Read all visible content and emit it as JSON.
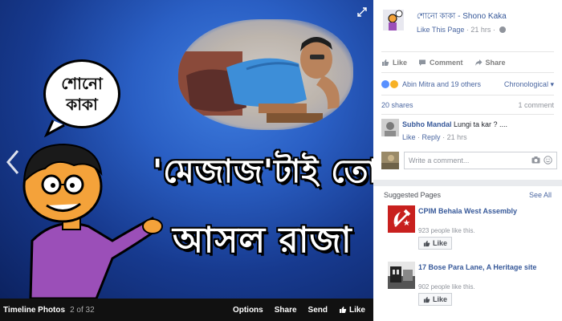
{
  "viewer": {
    "headline_1": "'মেজাজ'টাই তো",
    "headline_2": "আসল রাজা",
    "bubble_text": "শোনো\nকাকা",
    "bar": {
      "album": "Timeline Photos",
      "position": "2 of 32",
      "options": "Options",
      "share": "Share",
      "send": "Send",
      "like": "Like"
    }
  },
  "page": {
    "name": "শোনো কাকা - Shono Kaka",
    "like_this_page": "Like This Page",
    "time": "21 hrs"
  },
  "actions": {
    "like": "Like",
    "comment": "Comment",
    "share": "Share"
  },
  "reactions": {
    "names": "Abin Mitra and 19 others",
    "order": "Chronological"
  },
  "stats": {
    "shares": "20 shares",
    "comments": "1 comment"
  },
  "comment": {
    "author": "Subho Mandal",
    "text": "Lungi ta kar ? ....",
    "like": "Like",
    "reply": "Reply",
    "time": "21 hrs"
  },
  "composer": {
    "placeholder": "Write a comment..."
  },
  "suggested": {
    "title": "Suggested Pages",
    "see_all": "See All",
    "items": [
      {
        "name": "CPIM Behala West Assembly",
        "likes": "923 people like this.",
        "button": "Like"
      },
      {
        "name": "17 Bose Para Lane, A Heritage site",
        "likes": "902 people like this.",
        "button": "Like"
      }
    ]
  },
  "colors": {
    "link": "#365899",
    "fb_blue": "#4b67a1",
    "photo_bg": "#173a8f",
    "cpim_red": "#c8201e"
  }
}
